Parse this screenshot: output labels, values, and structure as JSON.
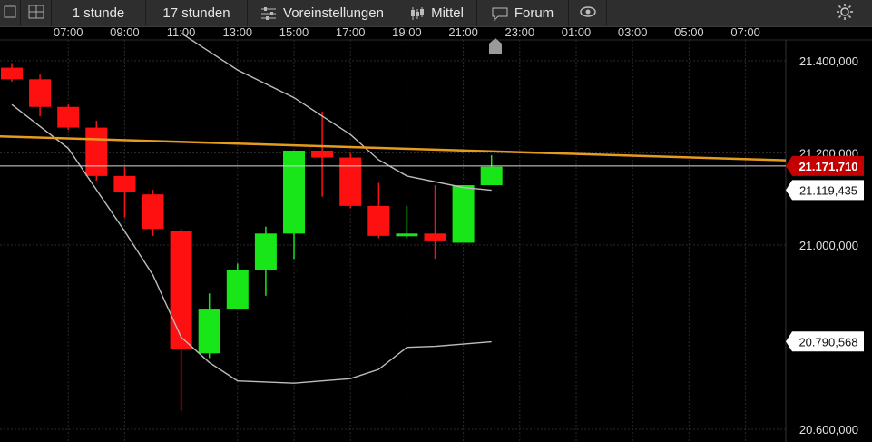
{
  "toolbar": {
    "items": [
      {
        "label": "",
        "icon": "chart-grid-icon"
      },
      {
        "label": "",
        "icon": "window-icon"
      },
      {
        "label": "1 stunde",
        "icon": ""
      },
      {
        "label": "17 stunden",
        "icon": ""
      },
      {
        "label": "Voreinstellungen",
        "icon": "sliders-icon"
      },
      {
        "label": "Mittel",
        "icon": "candlestick-icon"
      },
      {
        "label": "Forum",
        "icon": "speech-bubble-icon"
      },
      {
        "label": "",
        "icon": "eye-icon"
      },
      {
        "label": "",
        "icon": "settings-sun-icon"
      }
    ]
  },
  "colors": {
    "up": "#19e619",
    "down": "#ff1010",
    "ma": "#bdbdbd",
    "trend": "#e69a1e",
    "current_price_bg": "#c40000",
    "background": "#000000",
    "grid": "#2a2a2a"
  },
  "chart_data": {
    "type": "candlestick",
    "time_ticks": [
      "07:00",
      "09:00",
      "11:00",
      "13:00",
      "15:00",
      "17:00",
      "19:00",
      "21:00",
      "23:00",
      "01:00",
      "03:00",
      "05:00",
      "07:00"
    ],
    "price_ticks": [
      "21.400,000",
      "21.200,000",
      "21.000,000",
      "20.600,000"
    ],
    "ylim": [
      20600,
      21450
    ],
    "candles": [
      {
        "time": "05:00",
        "open": 21385,
        "high": 21395,
        "low": 21355,
        "close": 21360
      },
      {
        "time": "06:00",
        "open": 21360,
        "high": 21370,
        "low": 21280,
        "close": 21300
      },
      {
        "time": "07:00",
        "open": 21300,
        "high": 21305,
        "low": 21250,
        "close": 21255
      },
      {
        "time": "08:00",
        "open": 21255,
        "high": 21270,
        "low": 21140,
        "close": 21150
      },
      {
        "time": "09:00",
        "open": 21150,
        "high": 21170,
        "low": 21060,
        "close": 21115
      },
      {
        "time": "10:00",
        "open": 21110,
        "high": 21120,
        "low": 21020,
        "close": 21035
      },
      {
        "time": "11:00",
        "open": 21030,
        "high": 21035,
        "low": 20640,
        "close": 20775
      },
      {
        "time": "12:00",
        "open": 20765,
        "high": 20895,
        "low": 20755,
        "close": 20860
      },
      {
        "time": "13:00",
        "open": 20860,
        "high": 20960,
        "low": 20860,
        "close": 20945
      },
      {
        "time": "14:00",
        "open": 20945,
        "high": 21040,
        "low": 20890,
        "close": 21025
      },
      {
        "time": "15:00",
        "open": 21025,
        "high": 21200,
        "low": 20970,
        "close": 21205
      },
      {
        "time": "16:00",
        "open": 21205,
        "high": 21290,
        "low": 21105,
        "close": 21190
      },
      {
        "time": "17:00",
        "open": 21190,
        "high": 21200,
        "low": 21080,
        "close": 21085
      },
      {
        "time": "18:00",
        "open": 21085,
        "high": 21135,
        "low": 21015,
        "close": 21020
      },
      {
        "time": "19:00",
        "open": 21020,
        "high": 21085,
        "low": 21015,
        "close": 21025
      },
      {
        "time": "20:00",
        "open": 21025,
        "high": 21130,
        "low": 20970,
        "close": 21010
      },
      {
        "time": "21:00",
        "open": 21005,
        "high": 21130,
        "low": 21005,
        "close": 21130
      },
      {
        "time": "22:00",
        "open": 21130,
        "high": 21195,
        "low": 21130,
        "close": 21170
      }
    ],
    "moving_average_upper": {
      "name": "",
      "points": [
        {
          "time": "05:00",
          "value": 21305
        },
        {
          "time": "07:00",
          "value": 21210
        },
        {
          "time": "09:00",
          "value": 21030
        },
        {
          "time": "10:00",
          "value": 20935
        },
        {
          "time": "11:00",
          "value": 20800
        },
        {
          "time": "12:00",
          "value": 20745
        },
        {
          "time": "13:00",
          "value": 20705
        },
        {
          "time": "15:00",
          "value": 20700
        },
        {
          "time": "16:00",
          "value": 20705
        },
        {
          "time": "17:00",
          "value": 20710
        },
        {
          "time": "18:00",
          "value": 20730
        },
        {
          "time": "19:00",
          "value": 20778
        },
        {
          "time": "20:00",
          "value": 20780
        },
        {
          "time": "21:00",
          "value": 20785
        },
        {
          "time": "22:00",
          "value": 20790
        }
      ]
    },
    "moving_average_lower_label_value": "20.790,568",
    "moving_average_main": {
      "name": "",
      "points": [
        {
          "time": "11:00",
          "value": 21460
        },
        {
          "time": "13:00",
          "value": 21380
        },
        {
          "time": "15:00",
          "value": 21320
        },
        {
          "time": "17:00",
          "value": 21240
        },
        {
          "time": "18:00",
          "value": 21185
        },
        {
          "time": "19:00",
          "value": 21150
        },
        {
          "time": "21:00",
          "value": 21125
        },
        {
          "time": "22:00",
          "value": 21119
        }
      ]
    },
    "trend_line": {
      "start_value": 21236,
      "end_value": 21184
    },
    "current_price": "21.171,710",
    "ma_label": "21.119,435"
  }
}
